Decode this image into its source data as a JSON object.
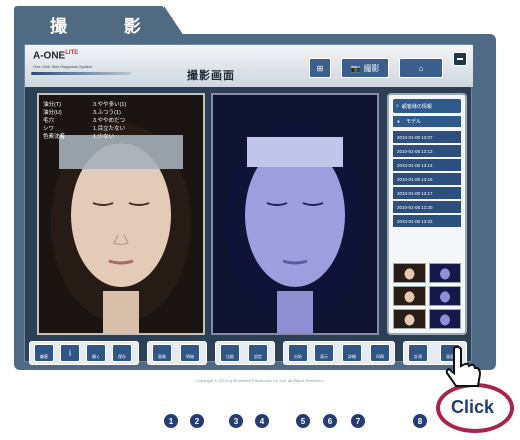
{
  "tab_title": "撮 影",
  "header": {
    "brand": "A-ONE",
    "brand_sup": "LITE",
    "brand_sub": "One Click Skin Diagnosis System",
    "screen_title": "撮影画面",
    "capture_button": "撮影"
  },
  "readout": {
    "rows": [
      {
        "label": "油分(T)",
        "value": "3.やや多い(1)"
      },
      {
        "label": "油分(U)",
        "value": "3.ふつう(1)"
      },
      {
        "label": "毛穴",
        "value": "3.ややめだつ"
      },
      {
        "label": "シワ",
        "value": "1.目立たない"
      },
      {
        "label": "色素沈着",
        "value": "1.少ない"
      }
    ]
  },
  "sidebar": {
    "search_label": "顧客様の情報",
    "model_label": "モデル",
    "dates": [
      "2010-01-08 13:07",
      "2010-01-08 13:13",
      "2010-01-08 13:14",
      "2010-01-08 13:16",
      "2010-01-08 13:17",
      "2010-01-08 13:20",
      "2010-01-08 13:22"
    ]
  },
  "toolbar": {
    "b1": "顧客",
    "b2": "i",
    "b3": "開く",
    "b4": "保存",
    "b5": "画像",
    "b6": "明暗",
    "b7": "比較",
    "b8": "設定",
    "b9": "分析",
    "b10": "表示",
    "b11": "詳細",
    "b12": "印刷",
    "b13": "計測",
    "b14": "画面"
  },
  "copyright": "Copyright © 2013 by Boomwell Electronics Co.,Ltd. All Rights Reserved.",
  "markers": [
    "1",
    "2",
    "3",
    "4",
    "5",
    "6",
    "7",
    "8"
  ],
  "click_label": "Click"
}
